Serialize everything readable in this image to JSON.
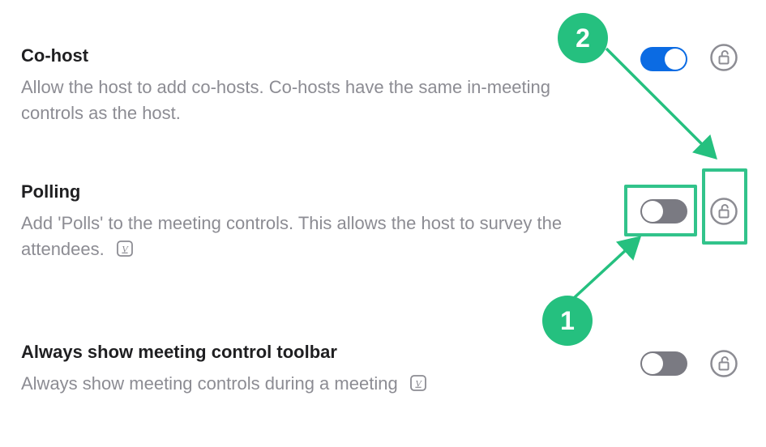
{
  "colors": {
    "accent_green": "#25c07f",
    "toggle_on": "#0b6be3",
    "toggle_off": "#7a7a82",
    "lock_stroke": "#8c8c93"
  },
  "settings": [
    {
      "title": "Co-host",
      "description": "Allow the host to add co-hosts. Co-hosts have the same in-meeting controls as the host.",
      "toggle_on": true,
      "locked": false,
      "has_info_icon": false
    },
    {
      "title": "Polling",
      "description": "Add 'Polls' to the meeting controls. This allows the host to survey the attendees.",
      "toggle_on": false,
      "locked": false,
      "has_info_icon": true
    },
    {
      "title": "Always show meeting control toolbar",
      "description": "Always show meeting controls during a meeting",
      "toggle_on": false,
      "locked": false,
      "has_info_icon": true
    }
  ],
  "annotations": {
    "marker1": "1",
    "marker2": "2"
  }
}
